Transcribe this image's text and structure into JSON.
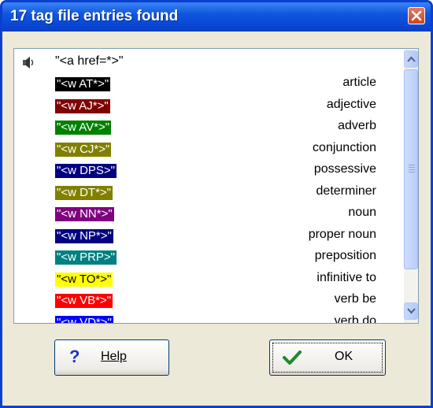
{
  "dialog": {
    "title": "17 tag file entries found"
  },
  "list": {
    "header": {
      "text": "\"<a href=*>\"",
      "icon": "speaker-icon"
    },
    "entries": [
      {
        "tag": "\"<w AT*>\"",
        "desc": "article",
        "bg": "#000000",
        "fg": "#ffffff"
      },
      {
        "tag": "\"<w AJ*>\"",
        "desc": "adjective",
        "bg": "#800000",
        "fg": "#ffffff"
      },
      {
        "tag": "\"<w AV*>\"",
        "desc": "adverb",
        "bg": "#008000",
        "fg": "#ffffff"
      },
      {
        "tag": "\"<w CJ*>\"",
        "desc": "conjunction",
        "bg": "#808000",
        "fg": "#ffffff"
      },
      {
        "tag": "\"<w DPS>\"",
        "desc": "possessive",
        "bg": "#000080",
        "fg": "#ffffff"
      },
      {
        "tag": "\"<w DT*>\"",
        "desc": "determiner",
        "bg": "#808000",
        "fg": "#ffffff"
      },
      {
        "tag": "\"<w NN*>\"",
        "desc": "noun",
        "bg": "#800080",
        "fg": "#ffffff"
      },
      {
        "tag": "\"<w NP*>\"",
        "desc": "proper noun",
        "bg": "#000080",
        "fg": "#ffffff"
      },
      {
        "tag": "\"<w PRP>\"",
        "desc": "preposition",
        "bg": "#008080",
        "fg": "#ffffff"
      },
      {
        "tag": "\"<w TO*>\"",
        "desc": "infinitive to",
        "bg": "#ffff00",
        "fg": "#000000"
      },
      {
        "tag": "\"<w VB*>\"",
        "desc": "verb be",
        "bg": "#ff0000",
        "fg": "#ffffff"
      },
      {
        "tag": "\"<w VD*>\"",
        "desc": "verb do",
        "bg": "#0000ff",
        "fg": "#ffffff"
      }
    ]
  },
  "buttons": {
    "help_label": "Help",
    "help_icon": "question-mark-icon",
    "ok_label": "OK",
    "ok_icon": "checkmark-icon"
  }
}
